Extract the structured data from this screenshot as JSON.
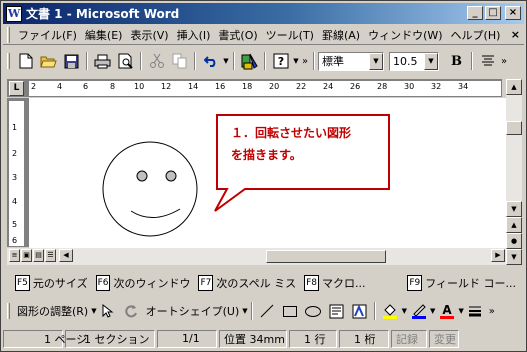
{
  "window": {
    "title": "文書 1 - Microsoft Word",
    "minimize": "_",
    "maximize": "□",
    "close": "×"
  },
  "menu": {
    "items": [
      "ファイル(F)",
      "編集(E)",
      "表示(V)",
      "挿入(I)",
      "書式(O)",
      "ツール(T)",
      "罫線(A)",
      "ウィンドウ(W)",
      "ヘルプ(H)"
    ],
    "close_glyph": "×"
  },
  "toolbar": {
    "style_value": "標準",
    "size_value": "10.5",
    "bold_label": "B",
    "more": "»"
  },
  "ruler": {
    "corner": "L",
    "ticks": [
      "2",
      "4",
      "6",
      "8",
      "10",
      "12",
      "14",
      "16",
      "18",
      "20",
      "22",
      "24",
      "26",
      "28",
      "30",
      "32",
      "34"
    ],
    "vticks": [
      "1",
      "2",
      "3",
      "4",
      "5",
      "6"
    ]
  },
  "document": {
    "callout_line1": "１．回転させたい図形",
    "callout_line2": "を描きます。",
    "callout_color": "#c00000"
  },
  "fkeys": [
    {
      "key": "F5",
      "label": "元のサイズ"
    },
    {
      "key": "F6",
      "label": "次のウィンドウ"
    },
    {
      "key": "F7",
      "label": "次のスペル ミス"
    },
    {
      "key": "F8",
      "label": "マクロ..."
    },
    {
      "key": "F9",
      "label": "フィールド コー..."
    }
  ],
  "drawbar": {
    "adjust_label": "図形の調整(R)",
    "autoshape_label": "オートシェイプ(U)",
    "fill_color": "#ffff00",
    "line_color": "#0000ff",
    "font_color": "#ff0000"
  },
  "status": {
    "page": "1 ページ",
    "section": "1 セクション",
    "pages": "1/1",
    "position": "位置 34mm",
    "line": "1 行",
    "column": "1 桁",
    "rec": "記録",
    "trk": "変更"
  }
}
